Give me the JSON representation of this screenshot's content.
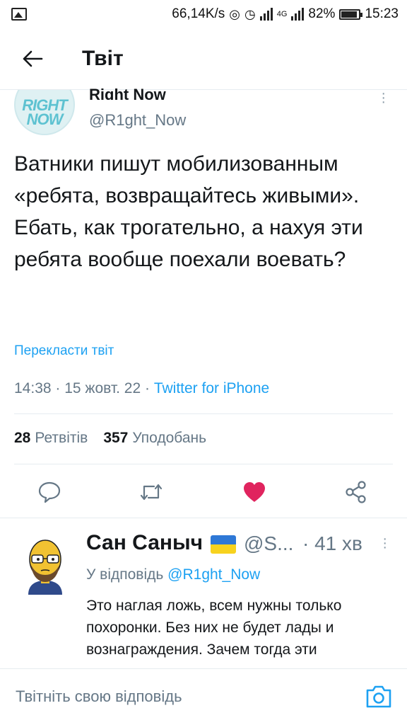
{
  "status_bar": {
    "speed": "66,14K/s",
    "network": "4G",
    "battery": "82%",
    "time": "15:23"
  },
  "header": {
    "title": "Твіт"
  },
  "tweet": {
    "author_name": "Right Now",
    "author_handle": "@R1ght_Now",
    "avatar_text": "RIGHT NOW",
    "text": "Ватники пишут мобилизованным «ребята, возвращайтесь живыми». Ебать, как трогательно, а нахуя эти ребята вообще поехали воевать?",
    "translate_label": "Перекласти твіт",
    "meta_time": "14:38 · 15 жовт. 22 · ",
    "meta_source": "Twitter for iPhone",
    "retweets_count": "28",
    "retweets_label": "Ретвітів",
    "likes_count": "357",
    "likes_label": "Уподобань",
    "liked": true
  },
  "reply": {
    "name": "Сан Саныч",
    "handle": "@S...",
    "time": "· 41 хв",
    "replying_prefix": "У відповідь ",
    "replying_to": "@R1ght_Now",
    "text": "Это наглая ложь, всем нужны только похоронки. Без них не будет лады и вознаграждения. Зачем тогда эти"
  },
  "compose": {
    "placeholder": "Твітніть свою відповідь"
  },
  "colors": {
    "accent": "#1da1f2",
    "like": "#e0245e",
    "muted": "#657786"
  }
}
